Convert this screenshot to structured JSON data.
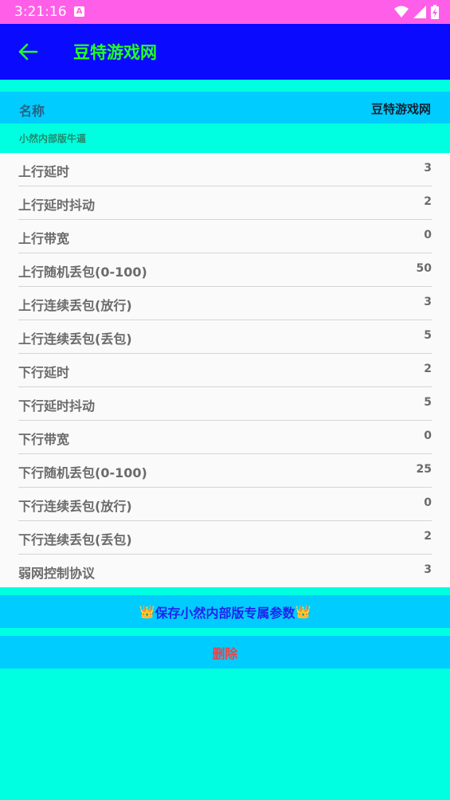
{
  "status_bar": {
    "time": "3:21:16",
    "notification_letter": "A"
  },
  "app_bar": {
    "title": "豆特游戏网"
  },
  "name_row": {
    "label": "名称",
    "value": "豆特游戏网"
  },
  "subtitle": "小然内部版牛逼",
  "params": [
    {
      "label": "上行延时",
      "value": "3"
    },
    {
      "label": "上行延时抖动",
      "value": "2"
    },
    {
      "label": "上行带宽",
      "value": "0"
    },
    {
      "label": "上行随机丢包(0-100)",
      "value": "50"
    },
    {
      "label": "上行连续丢包(放行)",
      "value": "3"
    },
    {
      "label": "上行连续丢包(丢包)",
      "value": "5"
    },
    {
      "label": "下行延时",
      "value": "2"
    },
    {
      "label": "下行延时抖动",
      "value": "5"
    },
    {
      "label": "下行带宽",
      "value": "0"
    },
    {
      "label": "下行随机丢包(0-100)",
      "value": "25"
    },
    {
      "label": "下行连续丢包(放行)",
      "value": "0"
    },
    {
      "label": "下行连续丢包(丢包)",
      "value": "2"
    },
    {
      "label": "弱网控制协议",
      "value": "3"
    }
  ],
  "buttons": {
    "save_label": "保存小然内部版专属参数",
    "delete_label": "删除"
  },
  "colors": {
    "status_bar": "#ff5fe8",
    "app_bar": "#0a0aff",
    "title": "#22ff22",
    "accent_row": "#00ccff",
    "background": "#00ffe0",
    "delete": "#ff3b3b"
  }
}
